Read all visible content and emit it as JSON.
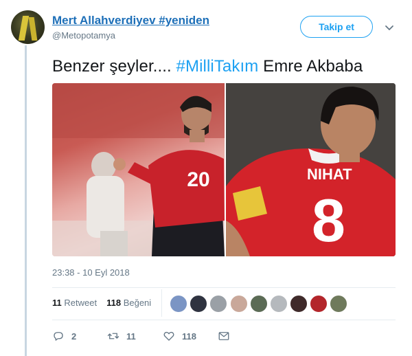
{
  "author": {
    "display_name": "Mert Allahverdiyev #yeniden",
    "username": "@Metopotamya"
  },
  "follow_button": {
    "label": "Takip et"
  },
  "tweet": {
    "text_before": "Benzer şeyler.... ",
    "hashtag": "#MilliTakım",
    "text_after": " Emre Akbaba"
  },
  "media": [
    {
      "jersey_number": "20"
    },
    {
      "name": "NIHAT",
      "jersey_number": "8"
    }
  ],
  "timestamp": "23:38 - 10 Eyl 2018",
  "stats": {
    "retweet_count": "11",
    "retweet_label": "Retweet",
    "like_count": "118",
    "like_label": "Beğeni"
  },
  "liker_avatar_colors": [
    "#7b95c4",
    "#2f3340",
    "#9aa0a6",
    "#c9a89a",
    "#5b6b55",
    "#b5b9bd",
    "#3f2a2a",
    "#b3262b",
    "#6f7a5c"
  ],
  "actions": {
    "reply_count": "2",
    "retweet_count": "11",
    "like_count": "118"
  },
  "colors": {
    "link": "#1d6fb8",
    "accent": "#1da1f2",
    "muted": "#657786"
  }
}
